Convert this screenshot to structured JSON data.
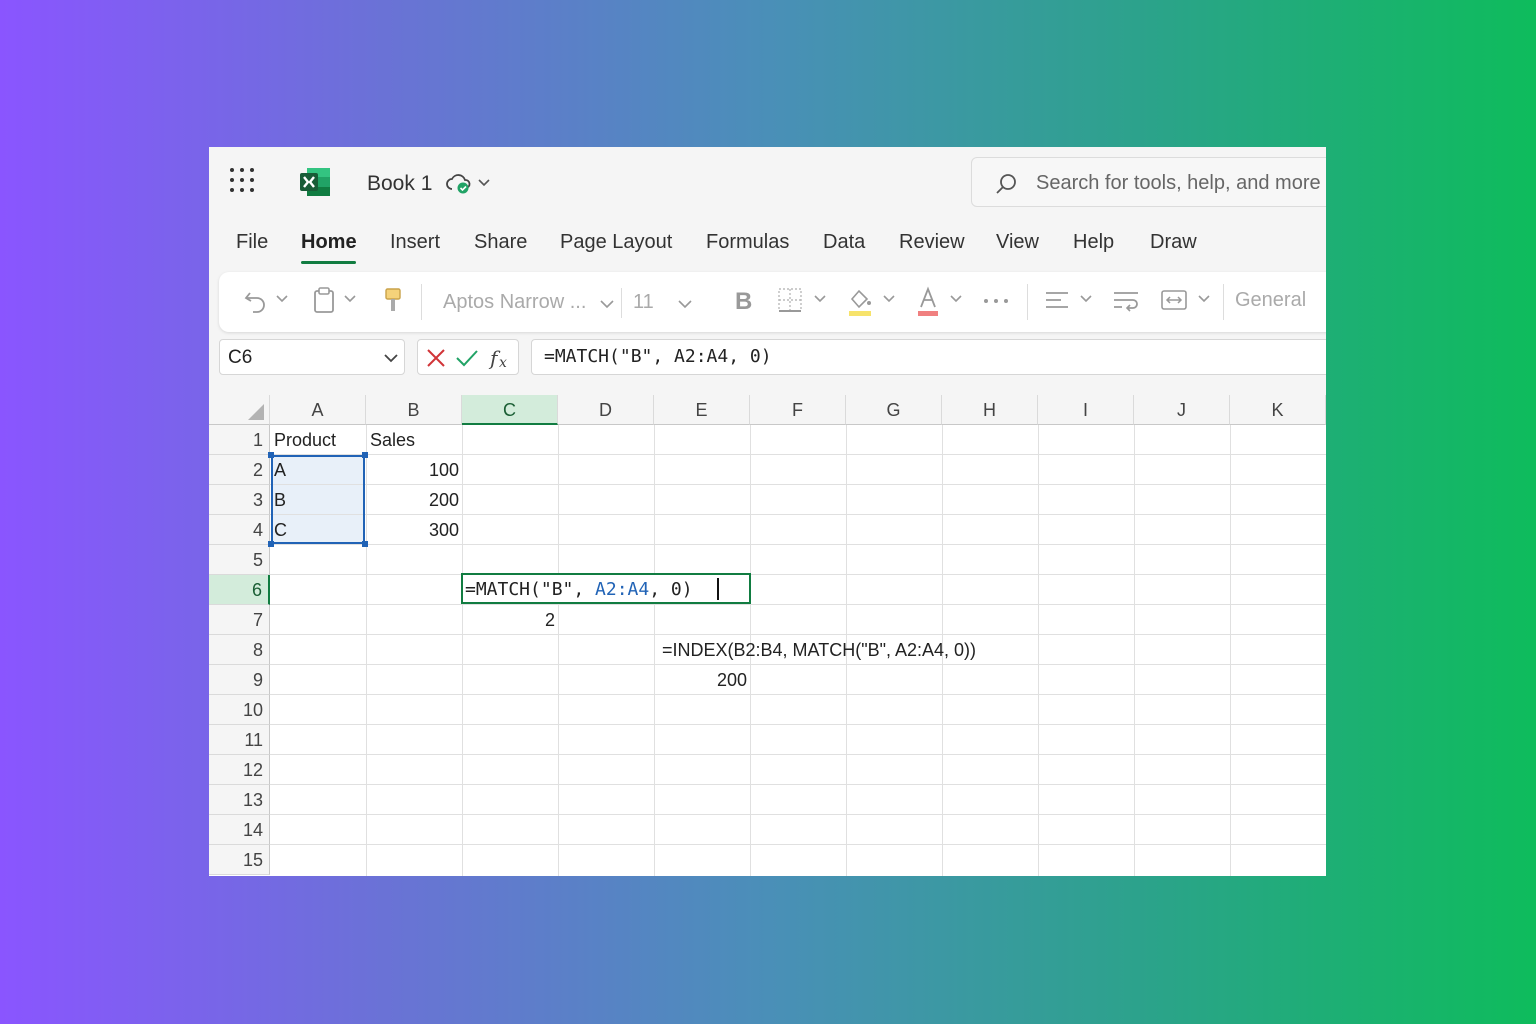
{
  "app": {
    "book_title": "Book 1",
    "search_placeholder": "Search for tools, help, and more",
    "brand_color": "#117c41"
  },
  "menu": {
    "tabs": [
      "File",
      "Home",
      "Insert",
      "Share",
      "Page Layout",
      "Formulas",
      "Data",
      "Review",
      "View",
      "Help",
      "Draw"
    ],
    "active": "Home"
  },
  "ribbon": {
    "font_name": "Aptos Narrow ...",
    "font_size": "11",
    "number_format": "General",
    "icons": [
      "undo-icon",
      "clipboard-icon",
      "format-painter-icon",
      "bold-icon",
      "borders-icon",
      "fill-color-icon",
      "font-color-icon",
      "more-icon",
      "align-icon",
      "wrap-text-icon",
      "merge-icon"
    ]
  },
  "formula_bar": {
    "name_box": "C6",
    "formula": "=MATCH(\"B\", A2:A4, 0)"
  },
  "grid": {
    "columns": [
      "A",
      "B",
      "C",
      "D",
      "E",
      "F",
      "G",
      "H",
      "I",
      "J",
      "K"
    ],
    "rows": [
      "1",
      "2",
      "3",
      "4",
      "5",
      "6",
      "7",
      "8",
      "9",
      "10",
      "11",
      "12",
      "13",
      "14",
      "15"
    ],
    "selected_column": "C",
    "selected_row": "6",
    "cells": {
      "A1": "Product",
      "B1": "Sales",
      "A2": "A",
      "B2": "100",
      "A3": "B",
      "B3": "200",
      "A4": "C",
      "B4": "300",
      "C7": "2",
      "E8": "=INDEX(B2:B4, MATCH(\"B\", A2:A4, 0))",
      "E9": "200"
    },
    "edit": {
      "prefix": "=MATCH(\"B\", ",
      "ref": "A2:A4",
      "suffix": ", 0)"
    }
  }
}
